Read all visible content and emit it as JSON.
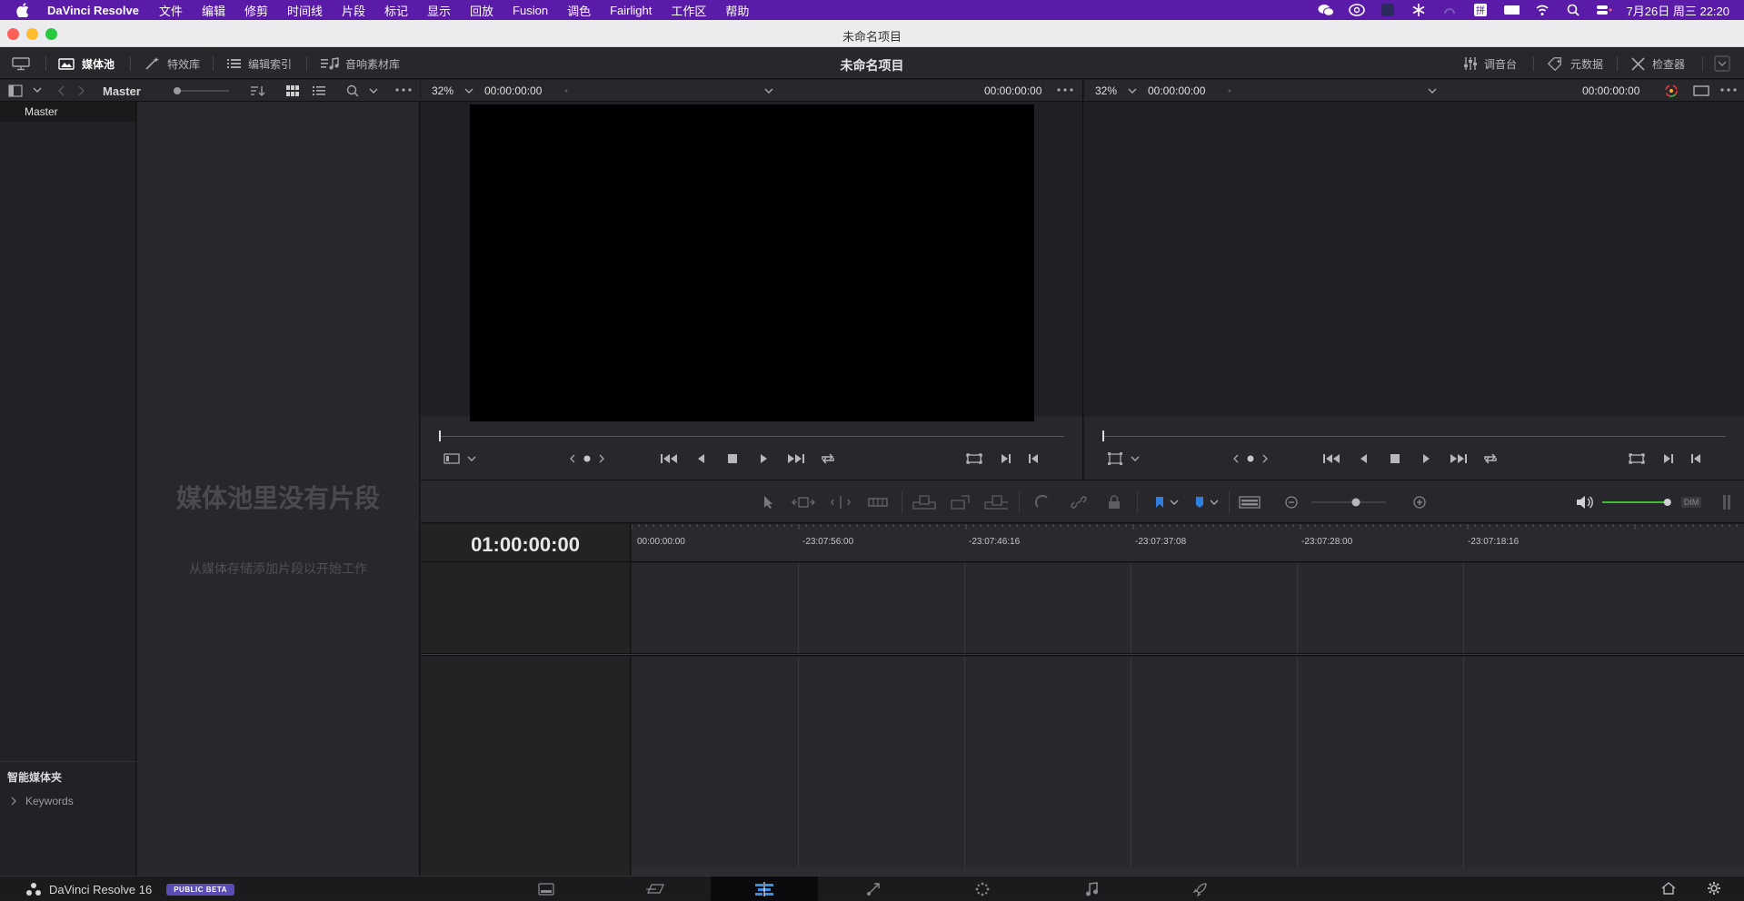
{
  "menubar": {
    "app_name": "DaVinci Resolve",
    "items": [
      "文件",
      "编辑",
      "修剪",
      "时间线",
      "片段",
      "标记",
      "显示",
      "回放",
      "Fusion",
      "调色",
      "Fairlight",
      "工作区",
      "帮助"
    ],
    "clock": "7月26日 周三  22:20"
  },
  "window": {
    "title": "未命名项目"
  },
  "toolbar": {
    "media_pool": "媒体池",
    "effects_library": "特效库",
    "edit_index": "编辑索引",
    "sound_library": "音响素材库",
    "project_title": "未命名项目",
    "mixer": "调音台",
    "metadata": "元数据",
    "inspector": "检查器"
  },
  "media_bar": {
    "bin_name": "Master"
  },
  "sidebar": {
    "master_bin": "Master",
    "smart_bins_title": "智能媒体夹",
    "keywords": "Keywords"
  },
  "media_pool": {
    "empty_title": "媒体池里没有片段",
    "empty_subtitle": "从媒体存储添加片段以开始工作"
  },
  "source_viewer": {
    "zoom": "32%",
    "timecode_left": "00:00:00:00",
    "timecode_right": "00:00:00:00"
  },
  "timeline_viewer": {
    "zoom": "32%",
    "timecode_left": "00:00:00:00",
    "timecode_right": "00:00:00:00"
  },
  "timeline": {
    "current_timecode": "01:00:00:00",
    "ruler_labels": [
      "00:00:00:00",
      "-23:07:56:00",
      "-23:07:46:16",
      "-23:07:37:08",
      "-23:07:28:00",
      "-23:07:18:16"
    ],
    "audio_meter_level": 0.97,
    "dim_label": "DIM"
  },
  "pagebar": {
    "brand": "DaVinci Resolve 16",
    "beta": "PUBLIC BETA",
    "pages": [
      "media",
      "cut",
      "edit",
      "fusion",
      "color",
      "fairlight",
      "deliver"
    ],
    "active_page": "edit"
  },
  "colors": {
    "menubar_bg": "#5a1ca8",
    "accent_blue": "#2f7fe0",
    "meter_green": "#3bbf2f",
    "beta_badge": "#5a4db5"
  }
}
